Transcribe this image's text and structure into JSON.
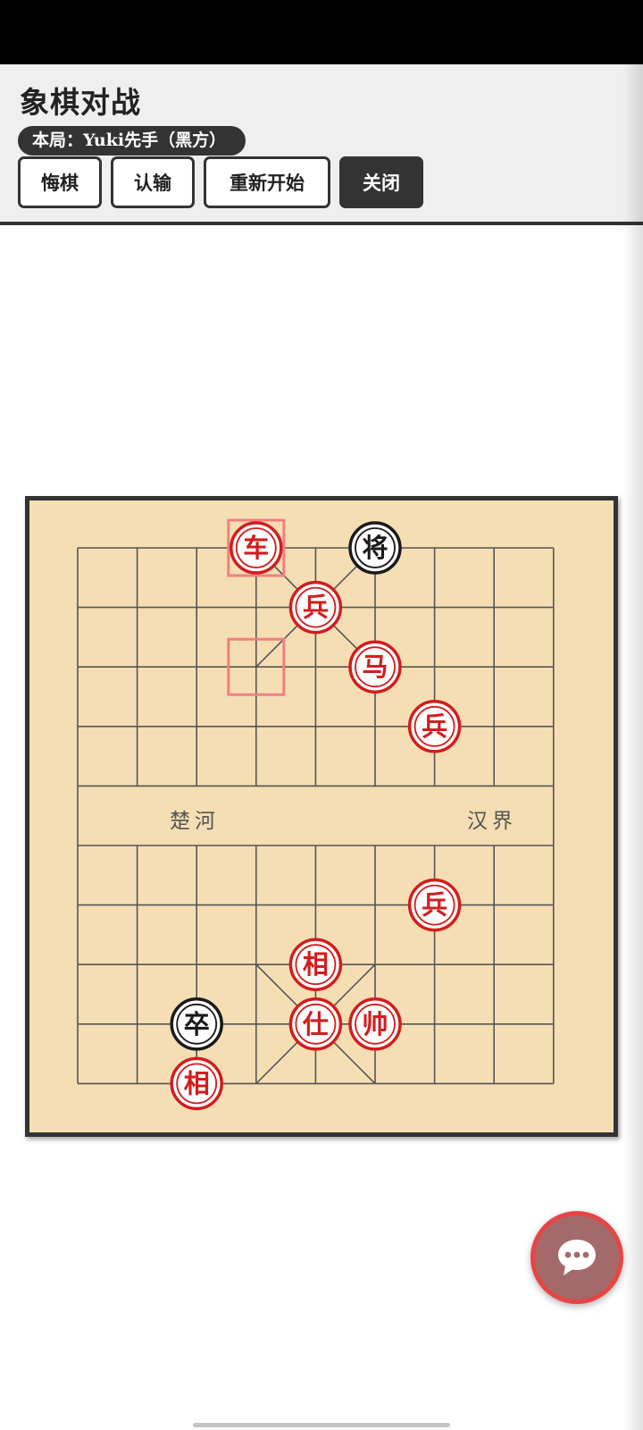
{
  "header": {
    "title": "象棋对战",
    "game_info": "本局：Yuki先手（黑方）"
  },
  "toolbar": {
    "undo_label": "悔棋",
    "resign_label": "认输",
    "restart_label": "重新开始",
    "close_label": "关闭"
  },
  "board": {
    "river_left": "楚河",
    "river_right": "汉界",
    "columns": 9,
    "rows": 10,
    "colors": {
      "background": "#f5deb3",
      "lines": "#555555",
      "red": "#d21d1d",
      "black": "#1a1a1a",
      "highlight": "#f08080"
    },
    "pieces": [
      {
        "char": "车",
        "side": "red",
        "col": 3,
        "row": 0
      },
      {
        "char": "将",
        "side": "black",
        "col": 5,
        "row": 0
      },
      {
        "char": "兵",
        "side": "red",
        "col": 4,
        "row": 1
      },
      {
        "char": "马",
        "side": "red",
        "col": 5,
        "row": 2
      },
      {
        "char": "兵",
        "side": "red",
        "col": 6,
        "row": 3
      },
      {
        "char": "兵",
        "side": "red",
        "col": 6,
        "row": 6
      },
      {
        "char": "相",
        "side": "red",
        "col": 4,
        "row": 7
      },
      {
        "char": "卒",
        "side": "black",
        "col": 2,
        "row": 8
      },
      {
        "char": "仕",
        "side": "red",
        "col": 4,
        "row": 8
      },
      {
        "char": "帅",
        "side": "red",
        "col": 5,
        "row": 8
      },
      {
        "char": "相",
        "side": "red",
        "col": 2,
        "row": 9
      }
    ],
    "last_move": {
      "from": {
        "col": 3,
        "row": 2
      },
      "to": {
        "col": 3,
        "row": 0
      }
    }
  },
  "chat_button": {
    "icon": "chat-bubble-icon"
  }
}
